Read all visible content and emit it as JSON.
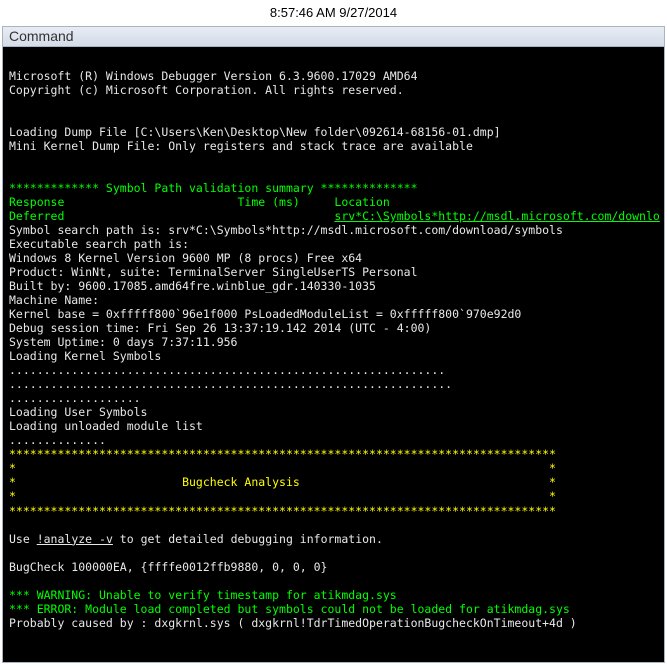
{
  "timestamp": "8:57:46 AM 9/27/2014",
  "window_title": "Command",
  "console": {
    "l01": "",
    "l02": "Microsoft (R) Windows Debugger Version 6.3.9600.17029 AMD64",
    "l03": "Copyright (c) Microsoft Corporation. All rights reserved.",
    "l04": "",
    "l05": "",
    "l06": "Loading Dump File [C:\\Users\\Ken\\Desktop\\New folder\\092614-68156-01.dmp]",
    "l07": "Mini Kernel Dump File: Only registers and stack trace are available",
    "l08": "",
    "l09": "",
    "l10": "************* Symbol Path validation summary **************",
    "l11a": "Response                         Time (ms)     Location",
    "l12a": "Deferred                                       ",
    "l12b": "srv*C:\\Symbols*http://msdl.microsoft.com/downlo",
    "l13": "Symbol search path is: srv*C:\\Symbols*http://msdl.microsoft.com/download/symbols",
    "l14": "Executable search path is: ",
    "l15": "Windows 8 Kernel Version 9600 MP (8 procs) Free x64",
    "l16": "Product: WinNt, suite: TerminalServer SingleUserTS Personal",
    "l17": "Built by: 9600.17085.amd64fre.winblue_gdr.140330-1035",
    "l18": "Machine Name:",
    "l19": "Kernel base = 0xfffff800`96e1f000 PsLoadedModuleList = 0xfffff800`970e92d0",
    "l20": "Debug session time: Fri Sep 26 13:37:19.142 2014 (UTC - 4:00)",
    "l21": "System Uptime: 0 days 7:37:11.956",
    "l22": "Loading Kernel Symbols",
    "l23": "...............................................................",
    "l24": "................................................................",
    "l25": "...................",
    "l26": "Loading User Symbols",
    "l27": "Loading unloaded module list",
    "l28": "..............",
    "l29": "*******************************************************************************",
    "l30": "*                                                                             *",
    "l31": "*                        Bugcheck Analysis                                    *",
    "l32": "*                                                                             *",
    "l33": "*******************************************************************************",
    "l34": "",
    "l35a": "Use ",
    "l35b": "!analyze -v",
    "l35c": " to get detailed debugging information.",
    "l36": "",
    "l37": "BugCheck 100000EA, {ffffe0012ffb9880, 0, 0, 0}",
    "l38": "",
    "l39": "*** WARNING: Unable to verify timestamp for atikmdag.sys",
    "l40": "*** ERROR: Module load completed but symbols could not be loaded for atikmdag.sys",
    "l41": "Probably caused by : dxgkrnl.sys ( dxgkrnl!TdrTimedOperationBugcheckOnTimeout+4d )"
  }
}
